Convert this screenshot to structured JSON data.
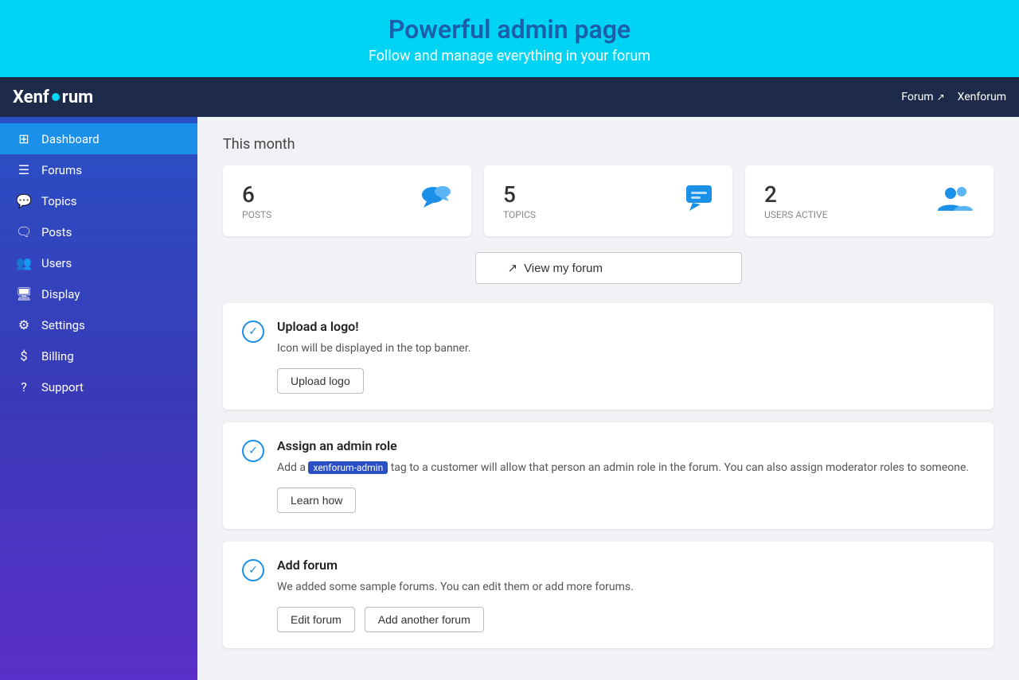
{
  "top_banner": {
    "headline": "Powerful admin page",
    "subheadline": "Follow and manage everything in your forum"
  },
  "navbar": {
    "brand": "Xenforum",
    "forum_link_label": "Forum",
    "forum_name": "Xenforum"
  },
  "sidebar": {
    "items": [
      {
        "id": "dashboard",
        "label": "Dashboard",
        "icon": "⊞",
        "active": true
      },
      {
        "id": "forums",
        "label": "Forums",
        "icon": "☰",
        "active": false
      },
      {
        "id": "topics",
        "label": "Topics",
        "icon": "💬",
        "active": false
      },
      {
        "id": "posts",
        "label": "Posts",
        "icon": "🗨",
        "active": false
      },
      {
        "id": "users",
        "label": "Users",
        "icon": "👥",
        "active": false
      },
      {
        "id": "display",
        "label": "Display",
        "icon": "🖥",
        "active": false
      },
      {
        "id": "settings",
        "label": "Settings",
        "icon": "⚙",
        "active": false
      },
      {
        "id": "billing",
        "label": "Billing",
        "icon": "$",
        "active": false
      },
      {
        "id": "support",
        "label": "Support",
        "icon": "?",
        "active": false
      }
    ]
  },
  "main": {
    "period_label": "This month",
    "stats": [
      {
        "number": "6",
        "label": "POSTS",
        "icon": "posts"
      },
      {
        "number": "5",
        "label": "TOPICS",
        "icon": "topics"
      },
      {
        "number": "2",
        "label": "USERS ACTIVE",
        "icon": "users"
      }
    ],
    "view_forum_button": "View my forum",
    "tasks": [
      {
        "id": "upload-logo",
        "title": "Upload a logo!",
        "description": "Icon will be displayed in the top banner.",
        "button_label": "Upload logo",
        "tag": null
      },
      {
        "id": "assign-admin",
        "title": "Assign an admin role",
        "description_before": "Add a ",
        "tag": "xenforum-admin",
        "description_after": " tag to a customer will allow that person an admin role in the forum. You can also assign moderator roles to someone.",
        "button_label": "Learn how",
        "tag_visible": true
      },
      {
        "id": "add-forum",
        "title": "Add forum",
        "description": "We added some sample forums. You can edit them or add more forums.",
        "button_label": "Edit forum",
        "button2_label": "Add another forum",
        "tag": null
      }
    ]
  }
}
